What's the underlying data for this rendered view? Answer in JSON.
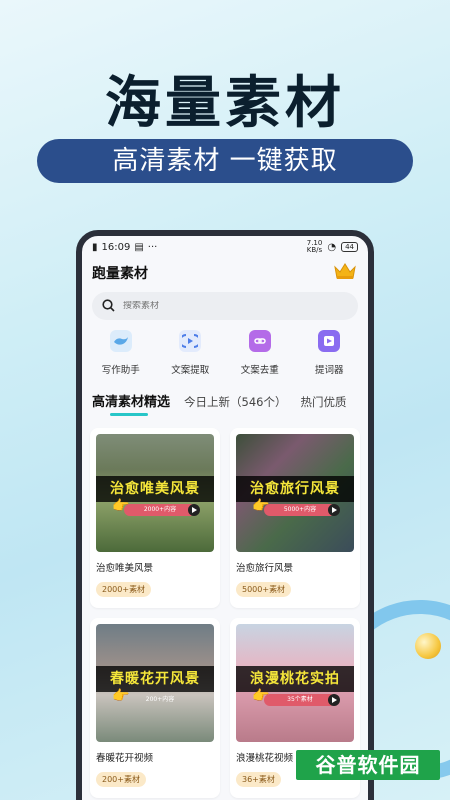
{
  "hero": {
    "title": "海量素材",
    "slogan": "高清素材 一键获取"
  },
  "status": {
    "time": "16:09",
    "dots": "···",
    "speed": "7.10\nKB/s",
    "battery": "44"
  },
  "app": {
    "title": "跑量素材"
  },
  "search": {
    "placeholder": "搜索素材"
  },
  "tools": [
    {
      "label": "写作助手",
      "icon": "whale-icon",
      "color": "#5aa8e8"
    },
    {
      "label": "文案提取",
      "icon": "extract-icon",
      "color": "#4d7de8"
    },
    {
      "label": "文案去重",
      "icon": "link-icon",
      "color": "#b46be8"
    },
    {
      "label": "提词器",
      "icon": "prompter-icon",
      "color": "#8a6cf0"
    }
  ],
  "tabs": [
    {
      "label": "高清素材精选"
    },
    {
      "label": "今日上新（546个）"
    },
    {
      "label": "热门优质"
    }
  ],
  "cards": [
    {
      "banner": "治愈唯美风景",
      "pill": "2000+内容",
      "title": "治愈唯美风景",
      "badge": "2000+素材"
    },
    {
      "banner": "治愈旅行风景",
      "pill": "5000+内容",
      "title": "治愈旅行风景",
      "badge": "5000+素材"
    },
    {
      "banner": "春暖花开风景",
      "pill": "200+内容",
      "title": "春暖花开视频",
      "badge": "200+素材"
    },
    {
      "banner": "浪漫桃花实拍",
      "pill": "35个素材",
      "title": "浪漫桃花视频",
      "badge": "36+素材"
    }
  ],
  "watermark": "谷普软件园",
  "colors": {
    "accent": "#28c6c8",
    "slogan_bg": "#2b4e8c",
    "badge_bg": "#fbe9c8"
  }
}
